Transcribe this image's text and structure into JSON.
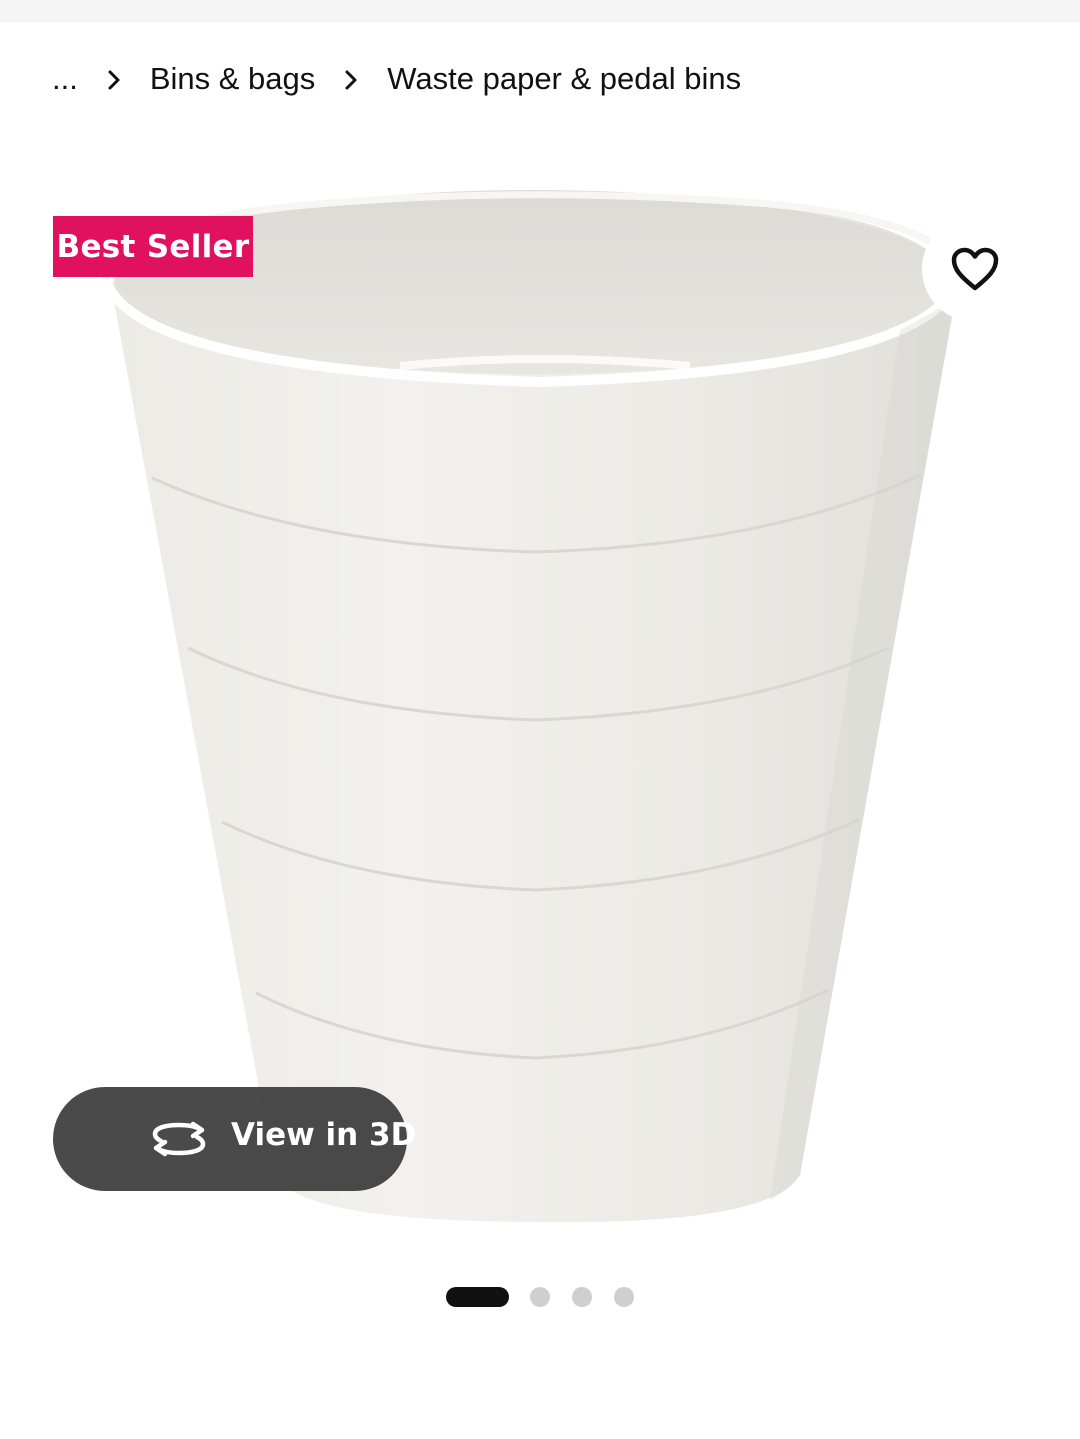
{
  "breadcrumb": {
    "items": [
      {
        "label": "..."
      },
      {
        "label": "Bins & bags"
      },
      {
        "label": "Waste paper & pedal bins"
      }
    ]
  },
  "product": {
    "badge": "Best Seller",
    "badge_color": "#e0115f",
    "view_3d_label": "View in 3D",
    "view_3d_icon": "rotate-3d-icon",
    "favourite_icon": "heart-outline-icon"
  },
  "carousel": {
    "total_images": 4,
    "active_index": 0
  }
}
